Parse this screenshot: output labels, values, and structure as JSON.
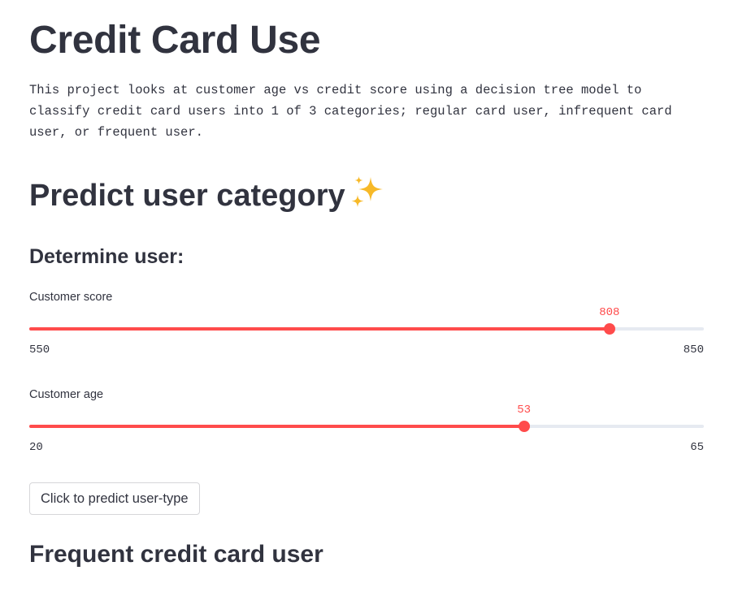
{
  "page": {
    "title": "Credit Card Use",
    "description": "This project looks at customer age vs credit score using a decision tree model to classify credit card users into 1 of 3 categories; regular card user, infrequent card user, or frequent user.",
    "section_title": "Predict user category",
    "section_icon": "sparkles-icon",
    "subheader": "Determine user:"
  },
  "sliders": [
    {
      "label": "Customer score",
      "min": 550,
      "max": 850,
      "value": 808
    },
    {
      "label": "Customer age",
      "min": 20,
      "max": 65,
      "value": 53
    }
  ],
  "predict_button": {
    "label": "Click to predict user-type"
  },
  "result": {
    "text": "Frequent credit card user"
  },
  "colors": {
    "accent": "#ff4b4b",
    "track": "#e6eaf1",
    "text": "#31333f",
    "sparkle": "#f7b928"
  }
}
